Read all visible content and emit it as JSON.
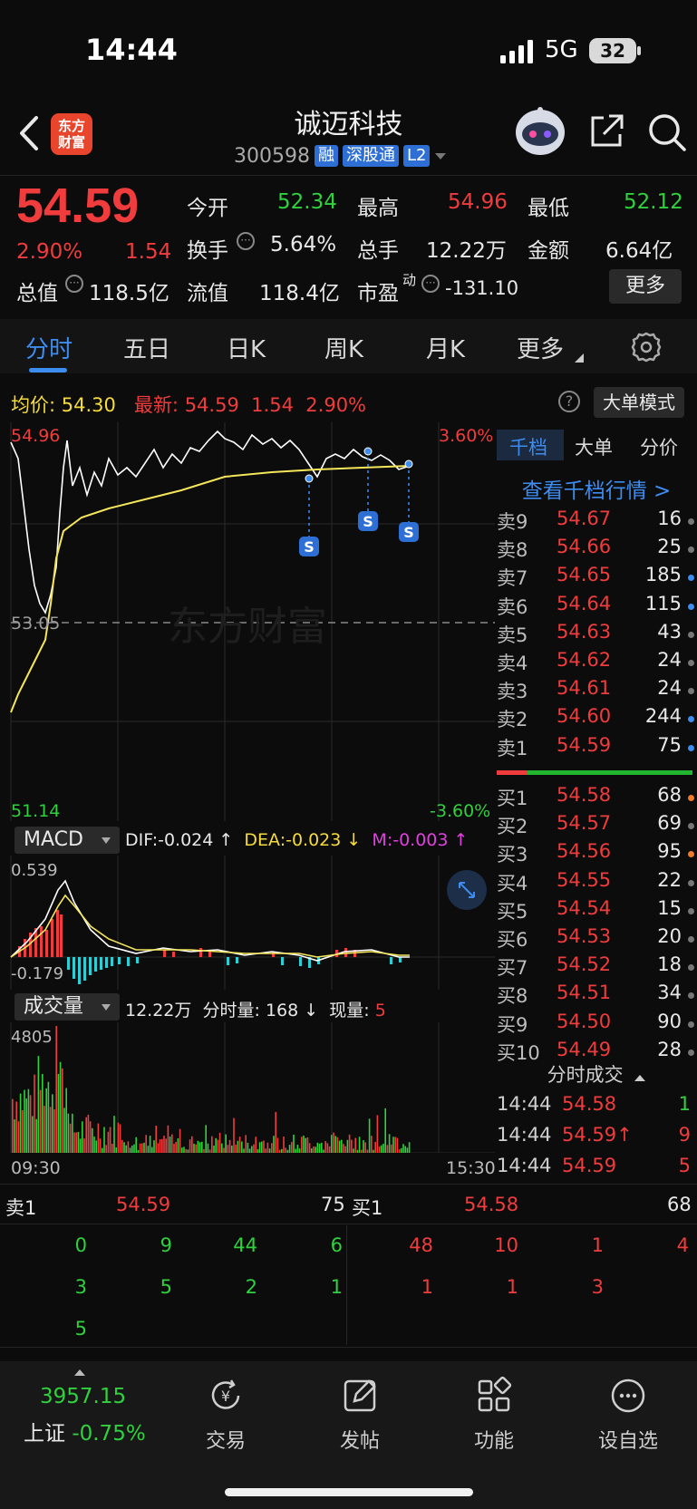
{
  "status": {
    "time": "14:44",
    "network": "5G",
    "battery": "32"
  },
  "header": {
    "stock_name": "诚迈科技",
    "code": "300598",
    "tags": [
      "融",
      "深股通",
      "L2"
    ],
    "logo_text_1": "东方",
    "logo_text_2": "财富"
  },
  "quote": {
    "price": "54.59",
    "change_pct": "2.90%",
    "change": "1.54",
    "open_label": "今开",
    "open": "52.34",
    "high_label": "最高",
    "high": "54.96",
    "low_label": "最低",
    "low": "52.12",
    "turnover_label": "换手",
    "turnover": "5.64%",
    "volume_label": "总手",
    "volume": "12.22万",
    "amount_label": "金额",
    "amount": "6.64亿",
    "mktcap_label": "总值",
    "mktcap": "118.5亿",
    "float_label": "流值",
    "float": "118.4亿",
    "pe_label": "市盈",
    "pe_sup": "动",
    "pe": "-131.10",
    "more_button": "更多"
  },
  "tabs": [
    "分时",
    "五日",
    "日K",
    "周K",
    "月K",
    "更多"
  ],
  "info_line": {
    "avg_label": "均价:",
    "avg": "54.30",
    "latest_label": "最新:",
    "latest": "54.59",
    "latest_change": "1.54",
    "latest_pct": "2.90%",
    "big_order_mode": "大单模式",
    "help": "?"
  },
  "price_chart": {
    "top_left": "54.96",
    "mid_left": "53.05",
    "bottom_left": "51.14",
    "top_right": "3.60%",
    "bottom_right": "-3.60%",
    "watermark": "东方财富",
    "signal_label": "S"
  },
  "macd": {
    "label": "MACD",
    "dif": "DIF:-0.024 ↑",
    "dea": "DEA:-0.023 ↓",
    "m": "M:-0.003 ↑",
    "max": "0.539",
    "min": "-0.179"
  },
  "volume_panel": {
    "label": "成交量",
    "total": "12.22万",
    "minute_label": "分时量:",
    "minute_val": "168 ↓",
    "now_label": "现量:",
    "now_val": "5",
    "max": "4805",
    "start_time": "09:30",
    "end_time": "15:30"
  },
  "order_book": {
    "tabs": [
      "千档",
      "大单",
      "分价"
    ],
    "link": "查看千档行情 >",
    "asks": [
      {
        "label": "卖9",
        "price": "54.67",
        "vol": "16",
        "dot": "#777777"
      },
      {
        "label": "卖8",
        "price": "54.66",
        "vol": "25",
        "dot": "#777777"
      },
      {
        "label": "卖7",
        "price": "54.65",
        "vol": "185",
        "dot": "#3d8cf0"
      },
      {
        "label": "卖6",
        "price": "54.64",
        "vol": "115",
        "dot": "#3d8cf0"
      },
      {
        "label": "卖5",
        "price": "54.63",
        "vol": "43",
        "dot": "#777777"
      },
      {
        "label": "卖4",
        "price": "54.62",
        "vol": "24",
        "dot": "#777777"
      },
      {
        "label": "卖3",
        "price": "54.61",
        "vol": "24",
        "dot": "#777777"
      },
      {
        "label": "卖2",
        "price": "54.60",
        "vol": "244",
        "dot": "#3d8cf0"
      },
      {
        "label": "卖1",
        "price": "54.59",
        "vol": "75",
        "dot": "#3d8cf0"
      }
    ],
    "bids": [
      {
        "label": "买1",
        "price": "54.58",
        "vol": "68",
        "dot": "#f07a2c"
      },
      {
        "label": "买2",
        "price": "54.57",
        "vol": "69",
        "dot": "#777777"
      },
      {
        "label": "买3",
        "price": "54.56",
        "vol": "95",
        "dot": "#f07a2c"
      },
      {
        "label": "买4",
        "price": "54.55",
        "vol": "22",
        "dot": "#777777"
      },
      {
        "label": "买5",
        "price": "54.54",
        "vol": "15",
        "dot": "#777777"
      },
      {
        "label": "买6",
        "price": "54.53",
        "vol": "20",
        "dot": "#777777"
      },
      {
        "label": "买7",
        "price": "54.52",
        "vol": "18",
        "dot": "#777777"
      },
      {
        "label": "买8",
        "price": "54.51",
        "vol": "34",
        "dot": "#777777"
      },
      {
        "label": "买9",
        "price": "54.50",
        "vol": "90",
        "dot": "#777777"
      },
      {
        "label": "买10",
        "price": "54.49",
        "vol": "28",
        "dot": "#777777"
      }
    ],
    "trade_title": "分时成交",
    "trades": [
      {
        "time": "14:44",
        "price": "54.58",
        "vol": "1",
        "color": "#2fd13d"
      },
      {
        "time": "14:44",
        "price": "54.59↑",
        "vol": "9",
        "color": "#f03c3c"
      },
      {
        "time": "14:44",
        "price": "54.59",
        "vol": "5",
        "color": "#f03c3c"
      }
    ]
  },
  "queue": {
    "sell_label": "卖1",
    "sell_price": "54.59",
    "sell_vol": "75",
    "buy_label": "买1",
    "buy_price": "54.58",
    "buy_vol": "68",
    "sell_queue": [
      "0",
      "9",
      "44",
      "6",
      "3",
      "5",
      "2",
      "1",
      "5"
    ],
    "buy_queue": [
      "48",
      "10",
      "1",
      "4",
      "1",
      "1",
      "3"
    ]
  },
  "bottom_nav": {
    "index_value": "3957.15",
    "index_name": "上证",
    "index_change": "-0.75%",
    "items": [
      "交易",
      "发帖",
      "功能",
      "设自选"
    ],
    "trade_icon_glyph": "¥"
  },
  "colors": {
    "up": "#f03c3c",
    "down": "#2fd13d",
    "accent": "#3d8cf0",
    "avg_line": "#f5e65a"
  }
}
